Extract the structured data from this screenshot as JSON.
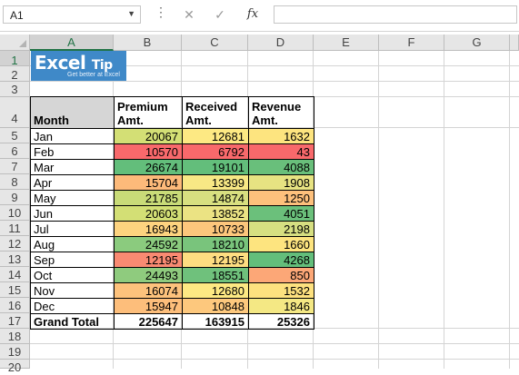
{
  "toolbar": {
    "name_box": "A1",
    "fx_label": "fx",
    "formula_value": ""
  },
  "columns": [
    "A",
    "B",
    "C",
    "D",
    "E",
    "F",
    "G"
  ],
  "rows": [
    "1",
    "2",
    "3",
    "4",
    "5",
    "6",
    "7",
    "8",
    "9",
    "10",
    "11",
    "12",
    "13",
    "14",
    "15",
    "16",
    "17",
    "18",
    "19",
    "20"
  ],
  "logo": {
    "word": "Excel",
    "word2": "Tip",
    "tagline": "Get better at Excel"
  },
  "table": {
    "headers": {
      "month": "Month",
      "premium_line1": "Premium",
      "premium_line2": "Amt.",
      "received_line1": "Received",
      "received_line2": "Amt.",
      "revenue_line1": "Revenue",
      "revenue_line2": "Amt."
    },
    "rows": [
      {
        "month": "Jan",
        "premium": "20067",
        "received": "12681",
        "revenue": "1632",
        "colors": [
          "#d3df75",
          "#fde983",
          "#fde47f"
        ]
      },
      {
        "month": "Feb",
        "premium": "10570",
        "received": "6792",
        "revenue": "43",
        "colors": [
          "#f8696b",
          "#f8696b",
          "#f8696b"
        ]
      },
      {
        "month": "Mar",
        "premium": "26674",
        "received": "19101",
        "revenue": "4088",
        "colors": [
          "#63be7b",
          "#63be7b",
          "#69bf7b"
        ]
      },
      {
        "month": "Apr",
        "premium": "15704",
        "received": "13399",
        "revenue": "1908",
        "colors": [
          "#fdba7a",
          "#f8e885",
          "#e7e382"
        ]
      },
      {
        "month": "May",
        "premium": "21785",
        "received": "14874",
        "revenue": "1250",
        "colors": [
          "#c9db78",
          "#d8df80",
          "#fdc07c"
        ]
      },
      {
        "month": "Jun",
        "premium": "20603",
        "received": "13852",
        "revenue": "4051",
        "colors": [
          "#d3df75",
          "#ebe383",
          "#6bc07b"
        ]
      },
      {
        "month": "Jul",
        "premium": "16943",
        "received": "10733",
        "revenue": "2198",
        "colors": [
          "#fdd37f",
          "#fdc67c",
          "#d6df81"
        ]
      },
      {
        "month": "Aug",
        "premium": "24592",
        "received": "18210",
        "revenue": "1660",
        "colors": [
          "#8bcb7e",
          "#79c47c",
          "#fde47f"
        ]
      },
      {
        "month": "Sep",
        "premium": "12195",
        "received": "12195",
        "revenue": "4268",
        "colors": [
          "#f98a72",
          "#fedd81",
          "#63be7b"
        ]
      },
      {
        "month": "Oct",
        "premium": "24493",
        "received": "18551",
        "revenue": "850",
        "colors": [
          "#8fcb7e",
          "#6fc17c",
          "#fca777"
        ]
      },
      {
        "month": "Nov",
        "premium": "16074",
        "received": "12680",
        "revenue": "1532",
        "colors": [
          "#fdc27c",
          "#fde983",
          "#fde17f"
        ]
      },
      {
        "month": "Dec",
        "premium": "15947",
        "received": "10848",
        "revenue": "1846",
        "colors": [
          "#fdbe7b",
          "#fdc87d",
          "#f4e884"
        ]
      }
    ],
    "total": {
      "label": "Grand Total",
      "premium": "225647",
      "received": "163915",
      "revenue": "25326"
    }
  }
}
